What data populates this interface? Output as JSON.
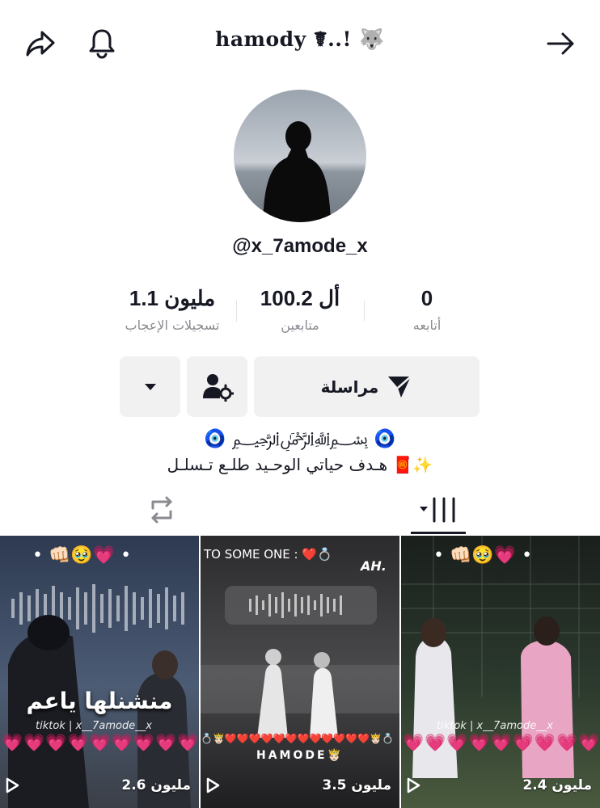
{
  "header": {
    "title": "hamody ☤..! 🐺",
    "icons": [
      "share-icon",
      "bell-icon",
      "arrow-right-icon"
    ]
  },
  "profile": {
    "username": "@x_7amode_x"
  },
  "stats": {
    "following_value": "0",
    "following_label": "أتابعه",
    "followers_value": "100.2 أل",
    "followers_label": "متابعين",
    "likes_value": "1.1 مليون",
    "likes_label": "تسجيلات الإعجاب"
  },
  "actions": {
    "message_label": "مراسلة",
    "icons": [
      "send-icon",
      "user-settings-icon",
      "dropdown-icon"
    ]
  },
  "bio": {
    "line1": "🧿 ﷽ 🧿",
    "line2": "هـدف حياتي الوحـيد طلـع تـسلـل 🧧✨"
  },
  "tabs": {
    "icons": [
      "repost-tab-icon",
      "videos-tab-icon"
    ],
    "active": "videos"
  },
  "videos": [
    {
      "views": "2.6 مليون",
      "top_emojis": "• 👊🏻🥹💗 •",
      "caption": "منشنلها ياعم",
      "watermark": "tiktok | x__7amode__x",
      "hearts": "💗💗💗💗💗💗💗💗💗"
    },
    {
      "views": "3.5 مليون",
      "top_text": "TO SOME ONE : ❤️💍",
      "logo": "AH.",
      "bottom_text": "HAMODE🤴🏻",
      "hearts": "💍🤴🏻❤️❤️❤️❤️❤️❤️❤️❤️❤️❤️❤️❤️🤴🏻💍"
    },
    {
      "views": "2.4 مليون",
      "top_emojis": "• 👊🏻🥹💗 •",
      "watermark": "tiktok | x__7amode__x",
      "hearts": "💗💗💗💗💗💗💗💗💗"
    }
  ],
  "colors": {
    "text_primary": "#161823",
    "text_secondary": "#8a8b91",
    "button_bg": "#f1f1f2"
  }
}
